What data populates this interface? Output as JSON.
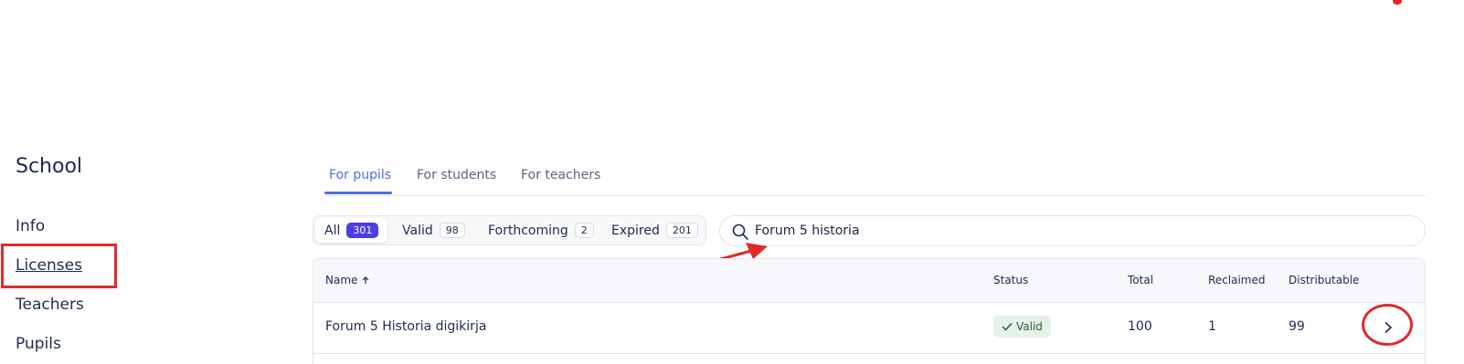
{
  "sidebar": {
    "title": "School",
    "items": [
      {
        "label": "Info"
      },
      {
        "label": "Licenses"
      },
      {
        "label": "Teachers"
      },
      {
        "label": "Pupils"
      }
    ]
  },
  "tabs": [
    {
      "label": "For pupils",
      "active": true
    },
    {
      "label": "For students"
    },
    {
      "label": "For teachers"
    }
  ],
  "filters": [
    {
      "label": "All",
      "count": "301",
      "active": true
    },
    {
      "label": "Valid",
      "count": "98"
    },
    {
      "label": "Forthcoming",
      "count": "2"
    },
    {
      "label": "Expired",
      "count": "201"
    }
  ],
  "search": {
    "value": "Forum 5 historia",
    "icon": "search-icon"
  },
  "table": {
    "columns": [
      "Name",
      "Status",
      "Total",
      "Reclaimed",
      "Distributable"
    ],
    "sort_icon": "arrow-up-icon",
    "rows": [
      {
        "name": "Forum 5 Historia digikirja",
        "status": "Valid",
        "total": "100",
        "reclaimed": "1",
        "distributable": "99"
      }
    ]
  },
  "colors": {
    "accent": "#4e6ee0",
    "count_active": "#4a3fe0",
    "annotation": "#e02a2a",
    "valid_badge_bg": "#e4f2e7"
  }
}
